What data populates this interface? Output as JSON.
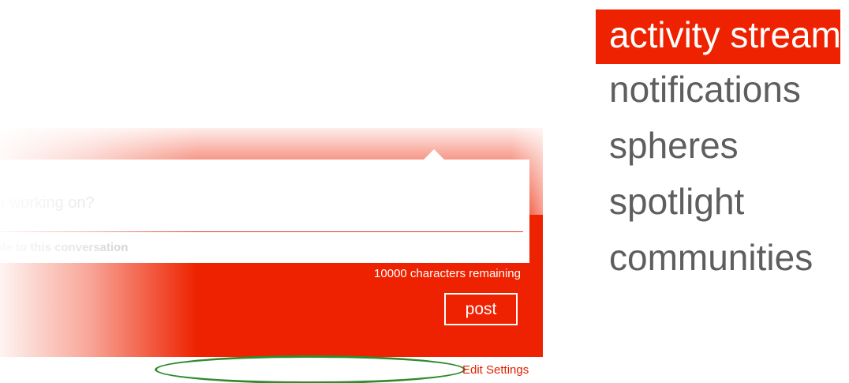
{
  "composer": {
    "prompt_placeholder": "you working on?",
    "invite_text": "ple to this conversation",
    "chars_remaining": "10000 characters remaining",
    "post_label": "post"
  },
  "footer": {
    "edit_settings_label": "Edit Settings"
  },
  "nav": {
    "items": [
      {
        "label": "activity stream",
        "active": true
      },
      {
        "label": "notifications",
        "active": false
      },
      {
        "label": "spheres",
        "active": false
      },
      {
        "label": "spotlight",
        "active": false
      },
      {
        "label": "communities",
        "active": false
      }
    ]
  },
  "colors": {
    "accent": "#ee2200",
    "annotation": "#2e8b2e",
    "nav_text": "#5e5e5e"
  }
}
